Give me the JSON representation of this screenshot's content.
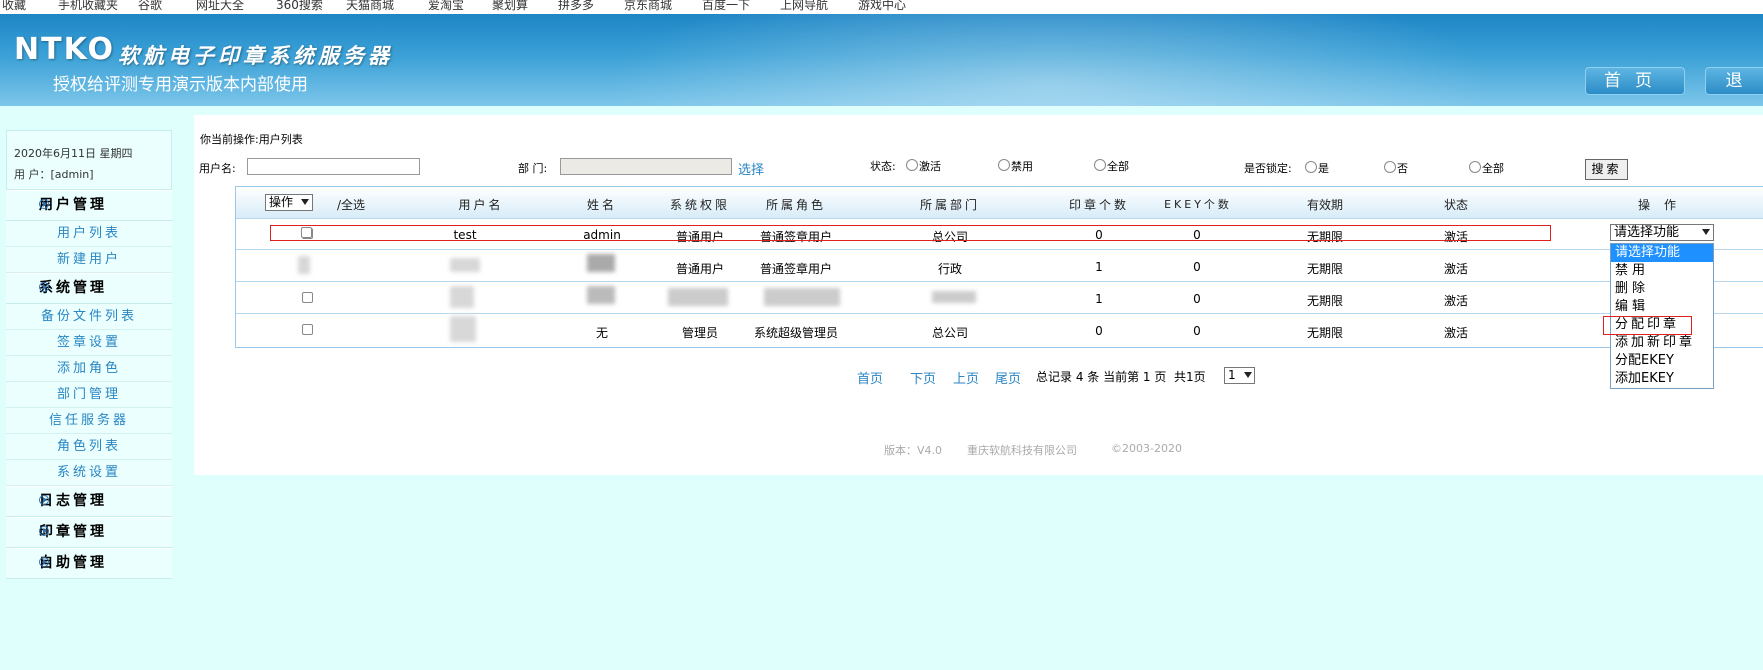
{
  "bookmarks": [
    "收藏",
    "手机收藏夹",
    "谷歌",
    "网址大全",
    "360搜索",
    "天猫商城",
    "爱淘宝",
    "聚划算",
    "拼多多",
    "京东商城",
    "百度一下",
    "上网导航",
    "游戏中心"
  ],
  "header": {
    "logo": "NTKO",
    "logo_sub": "软航电子印章系统服务器",
    "slogan": "授权给评测专用演示版本内部使用",
    "home_label": "首页",
    "exit_label": "退"
  },
  "sidebar": {
    "date": "2020年6月11日 星期四",
    "user": "用 户：[admin]",
    "groups": [
      {
        "label": "用户管理",
        "items": [
          "用户列表",
          "新建用户"
        ]
      },
      {
        "label": "系统管理",
        "items": [
          "备份文件列表",
          "签章设置",
          "添加角色",
          "部门管理",
          "信任服务器",
          "角色列表",
          "系统设置"
        ]
      },
      {
        "label": "日志管理",
        "items": []
      },
      {
        "label": "印章管理",
        "items": []
      },
      {
        "label": "自助管理",
        "items": []
      }
    ]
  },
  "filters": {
    "crumb": "你当前操作:用户列表",
    "username_label": "用户名:",
    "username_value": "",
    "dept_label": "部  门:",
    "dept_value": "",
    "select_link": "选择",
    "status_label": "状态:",
    "status_options": [
      "激活",
      "禁用",
      "全部"
    ],
    "locked_label": "是否锁定:",
    "locked_options": [
      "是",
      "否",
      "全部"
    ],
    "search_label": "搜索"
  },
  "table": {
    "action_select": "操作",
    "select_all": "/全选",
    "headers": [
      "用户名",
      "姓名",
      "系统权限",
      "所属角色",
      "所属部门",
      "印章个数",
      "EKEY个数",
      "有效期",
      "状态",
      "操作"
    ],
    "rows": [
      {
        "username": "test",
        "name": "admin",
        "perm": "普通用户",
        "role": "普通签章用户",
        "dept": "总公司",
        "seals": "0",
        "ekeys": "0",
        "valid": "无期限",
        "status": "激活"
      },
      {
        "username": "",
        "name": "",
        "perm": "普通用户",
        "role": "普通签章用户",
        "dept": "行政",
        "seals": "1",
        "ekeys": "0",
        "valid": "无期限",
        "status": "激活"
      },
      {
        "username": "",
        "name": "",
        "perm": "",
        "role": "",
        "dept": "",
        "seals": "1",
        "ekeys": "0",
        "valid": "无期限",
        "status": "激活"
      },
      {
        "username": "",
        "name": "无",
        "perm": "管理员",
        "role": "系统超级管理员",
        "dept": "总公司",
        "seals": "0",
        "ekeys": "0",
        "valid": "无期限",
        "status": "激活"
      }
    ],
    "op_select": "请选择功能",
    "op_options": [
      "请选择功能",
      "禁用",
      "删除",
      "编辑",
      "分配印章",
      "添加新印章",
      "分配EKEY",
      "添加EKEY"
    ]
  },
  "pager": {
    "first": "首页",
    "next": "下页",
    "prev": "上页",
    "last": "尾页",
    "summary": "总记录 4 条 当前第 1 页  共1页",
    "page_select": "1"
  },
  "footer": {
    "version": "版本：V4.0",
    "company": "重庆软航科技有限公司",
    "copyright": "©2003-2020"
  },
  "colors": {
    "link": "#2a86c4",
    "header": "#2e93cf",
    "highlight": "#e02020",
    "option_active": "#1e90ff"
  }
}
